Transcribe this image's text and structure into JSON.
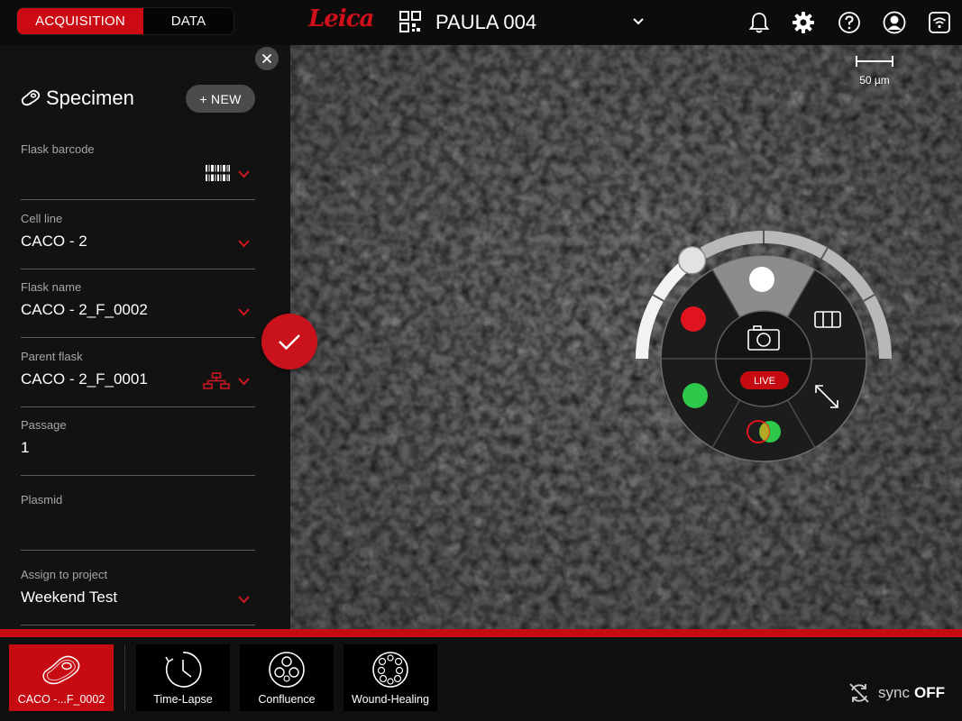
{
  "topbar": {
    "tabs": [
      {
        "label": "ACQUISITION",
        "active": true
      },
      {
        "label": "DATA",
        "active": false
      }
    ],
    "logo": "Leica",
    "device_name": "PAULA 004",
    "icons": [
      "grid-icon",
      "chevron-down-icon",
      "bell-icon",
      "gear-icon",
      "help-icon",
      "user-icon",
      "wifi-icon"
    ]
  },
  "specimen": {
    "title": "Specimen",
    "new_label": "+ NEW",
    "fields": [
      {
        "label": "Flask barcode",
        "value": ""
      },
      {
        "label": "Cell line",
        "value": "CACO - 2"
      },
      {
        "label": "Flask name",
        "value": "CACO - 2_F_0002"
      },
      {
        "label": "Parent flask",
        "value": "CACO - 2_F_0001"
      },
      {
        "label": "Passage",
        "value": "1"
      },
      {
        "label": "Plasmid",
        "value": ""
      },
      {
        "label": "Assign to project",
        "value": "Weekend Test"
      }
    ]
  },
  "viewer": {
    "scale_label": "50 µm",
    "live_label": "LIVE",
    "channels": [
      {
        "name": "red",
        "color": "#e0141e"
      },
      {
        "name": "brightfield",
        "color": "#ffffff"
      },
      {
        "name": "green",
        "color": "#2ec84a"
      }
    ],
    "intensity_fraction": 0.3
  },
  "bottom": {
    "tiles": [
      {
        "label": "CACO -...F_0002",
        "active": true
      },
      {
        "label": "Time-Lapse",
        "active": false
      },
      {
        "label": "Confluence",
        "active": false
      },
      {
        "label": "Wound-Healing",
        "active": false
      }
    ],
    "sync_label": "sync",
    "sync_state": "OFF"
  },
  "colors": {
    "accent": "#c60b13",
    "panel": "#121212",
    "topbar": "#0c0c0c"
  }
}
